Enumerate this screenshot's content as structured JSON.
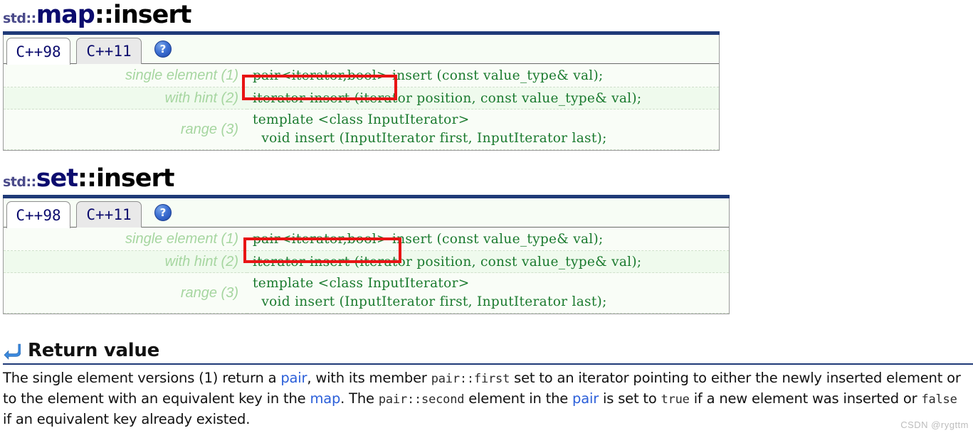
{
  "sections": [
    {
      "title": {
        "namespace": "std::",
        "class": "map",
        "separator": "::",
        "func": "insert"
      },
      "tabs": [
        {
          "label": "C++98",
          "state": "active"
        },
        {
          "label": "C++11",
          "state": "inactive"
        }
      ],
      "help_icon": "?",
      "rows": [
        {
          "label": "single element (1)",
          "code": "pair<iterator,bool> insert (const value_type& val);"
        },
        {
          "label": "with hint (2)",
          "code": "iterator insert (iterator position, const value_type& val);"
        },
        {
          "label": "range (3)",
          "code_line1": "template <class InputIterator>",
          "code_line2": "  void insert (InputIterator first, InputIterator last);"
        }
      ],
      "annotation": "pair<iterator,bool>"
    },
    {
      "title": {
        "namespace": "std::",
        "class": "set",
        "separator": "::",
        "func": "insert"
      },
      "tabs": [
        {
          "label": "C++98",
          "state": "active"
        },
        {
          "label": "C++11",
          "state": "inactive"
        }
      ],
      "help_icon": "?",
      "rows": [
        {
          "label": "single element (1)",
          "code": "pair<iterator,bool> insert (const value_type& val);"
        },
        {
          "label": "with hint (2)",
          "code": "iterator insert (iterator position, const value_type& val);"
        },
        {
          "label": "range (3)",
          "code_line1": "template <class InputIterator>",
          "code_line2": "  void insert (InputIterator first, InputIterator last);"
        }
      ],
      "annotation": "pair<iterator,bool>"
    }
  ],
  "return_value": {
    "icon": "return-arrow-icon",
    "heading": "Return value",
    "paragraph": {
      "t1": "The single element versions (1) return a ",
      "link1": "pair",
      "t2": ", with its member ",
      "code1": "pair::first",
      "t3": " set to an iterator pointing to either the newly inserted element or to the element with an equivalent key in the ",
      "link2": "map",
      "t4": ". The ",
      "code2": "pair::second",
      "t5": " element in the ",
      "link3": "pair",
      "t6": " is set to ",
      "code3": "true",
      "t7": " if a new element was inserted or ",
      "code4": "false",
      "t8": " if an equivalent key already existed."
    }
  },
  "watermark": "CSDN @rygttm",
  "colors": {
    "title_rule": "#1f3a78",
    "class_name": "#0c0c6e",
    "code_green": "#1a7a2e",
    "label_green": "#a6d6a0",
    "annotation_red": "#e81414",
    "link_blue": "#2b5fd9"
  }
}
